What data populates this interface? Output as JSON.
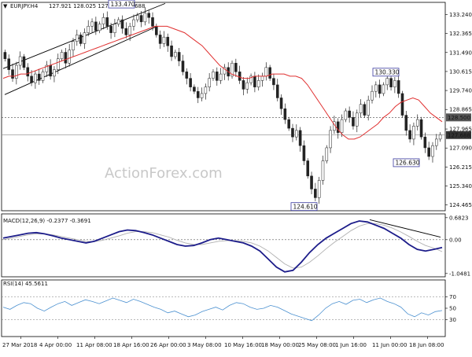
{
  "header": {
    "symbol": "EURJPY.H4",
    "ohlc": "127.921 128.025 127.602 127.688",
    "arrow": "▼"
  },
  "watermark": "ActionForex.com",
  "colors": {
    "candle": "#222222",
    "moving_average": "#e03030",
    "channel": "#000000",
    "macd_line": "#1c1c8a",
    "macd_signal": "#b0b0b0",
    "rsi_line": "#4a90d0",
    "label_border": "#3a3aa0",
    "current_price_bg": "#333333",
    "level_bg": "#555555"
  },
  "chart_data": [
    {
      "type": "candlestick",
      "title": "",
      "ylim": [
        124.2,
        133.8
      ],
      "y_ticks": [
        "133.240",
        "132.365",
        "131.490",
        "130.615",
        "129.740",
        "128.865",
        "127.965",
        "127.090",
        "126.215",
        "125.340",
        "124.465"
      ],
      "y_tick_values": [
        133.24,
        132.365,
        131.49,
        130.615,
        129.74,
        128.865,
        127.965,
        127.09,
        126.215,
        125.34,
        124.465
      ],
      "x_labels": [
        "27 Mar 2018",
        "4 Apr 00:00",
        "11 Apr 08:00",
        "18 Apr 16:00",
        "26 Apr 00:00",
        "3 May 08:00",
        "10 May 16:00",
        "18 May 00:00",
        "25 May 08:00",
        "1 Jun 16:00",
        "11 Jun 00:00",
        "18 Jun 08:00"
      ],
      "close_series": [
        131.2,
        130.7,
        130.3,
        130.9,
        131.3,
        130.8,
        130.4,
        130.1,
        130.5,
        130.2,
        130.6,
        130.9,
        130.4,
        130.7,
        131.2,
        131.5,
        131.0,
        131.6,
        132.0,
        132.3,
        131.9,
        132.4,
        132.7,
        132.9,
        132.5,
        132.8,
        133.1,
        132.7,
        132.4,
        132.8,
        133.0,
        132.6,
        132.3,
        132.7,
        133.0,
        133.2,
        132.9,
        133.3,
        133.1,
        132.7,
        132.3,
        131.9,
        132.2,
        131.8,
        131.3,
        131.5,
        131.1,
        130.6,
        130.3,
        129.9,
        129.7,
        129.4,
        129.6,
        129.9,
        130.3,
        130.6,
        130.2,
        130.5,
        130.8,
        130.4,
        131.0,
        130.6,
        130.2,
        129.8,
        130.1,
        130.4,
        129.9,
        130.2,
        130.4,
        130.8,
        130.3,
        130.0,
        129.4,
        128.9,
        128.4,
        128.0,
        127.6,
        127.9,
        127.2,
        126.5,
        125.8,
        125.2,
        124.8,
        125.6,
        126.5,
        127.1,
        127.9,
        128.3,
        127.8,
        128.4,
        128.8,
        128.5,
        128.1,
        128.7,
        129.1,
        128.6,
        129.3,
        129.7,
        130.0,
        129.6,
        130.0,
        130.3,
        129.9,
        130.2,
        129.6,
        128.6,
        127.9,
        127.5,
        128.1,
        128.4,
        127.6,
        127.1,
        126.7,
        127.2,
        127.5,
        127.7
      ],
      "ma_series": [
        130.3,
        130.4,
        130.4,
        130.5,
        130.5,
        130.6,
        130.7,
        130.8,
        130.9,
        131.0,
        131.1,
        131.2,
        131.3,
        131.4,
        131.5,
        131.6,
        131.7,
        131.8,
        131.9,
        132.0,
        132.1,
        132.2,
        132.3,
        132.4,
        132.5,
        132.6,
        132.7,
        132.7,
        132.7,
        132.6,
        132.5,
        132.4,
        132.2,
        132.0,
        131.8,
        131.5,
        131.2,
        130.9,
        130.7,
        130.5,
        130.4,
        130.3,
        130.3,
        130.4,
        130.4,
        130.4,
        130.5,
        130.5,
        130.5,
        130.4,
        130.4,
        130.3,
        130.0,
        129.6,
        129.2,
        128.8,
        128.4,
        128.0,
        127.7,
        127.5,
        127.5,
        127.6,
        127.8,
        128.0,
        128.2,
        128.5,
        128.7,
        129.0,
        129.2,
        129.3,
        129.4,
        129.3,
        129.0,
        128.7,
        128.5,
        128.3
      ],
      "resistance_level": 128.5,
      "current_price": 127.688,
      "price_labels": [
        {
          "label": "133.470",
          "value": 133.47
        },
        {
          "label": "130.330",
          "value": 130.33
        },
        {
          "label": "126.630",
          "value": 126.63
        },
        {
          "label": "124.610",
          "value": 124.61
        }
      ],
      "current_price_label": "127.688",
      "level_label": "128.500"
    },
    {
      "type": "line",
      "title": "MACD(12,26,9) -0.2377 -0.3691",
      "ylim": [
        -1.15,
        0.8
      ],
      "y_ticks": [
        "0.6823",
        "0.00",
        "-1.0481"
      ],
      "y_tick_values": [
        0.6823,
        0.0,
        -1.0481
      ],
      "series": [
        {
          "name": "MACD",
          "values": [
            0.05,
            0.1,
            0.15,
            0.2,
            0.22,
            0.18,
            0.12,
            0.05,
            0.0,
            -0.05,
            -0.1,
            -0.05,
            0.05,
            0.15,
            0.25,
            0.3,
            0.28,
            0.22,
            0.15,
            0.05,
            -0.05,
            -0.15,
            -0.2,
            -0.18,
            -0.1,
            0.0,
            0.05,
            0.0,
            -0.05,
            -0.1,
            -0.2,
            -0.35,
            -0.6,
            -0.85,
            -1.0,
            -0.95,
            -0.7,
            -0.4,
            -0.15,
            0.05,
            0.2,
            0.35,
            0.5,
            0.58,
            0.55,
            0.45,
            0.35,
            0.2,
            0.05,
            -0.15,
            -0.3,
            -0.35,
            -0.3,
            -0.24
          ]
        },
        {
          "name": "Signal",
          "values": [
            0.0,
            0.05,
            0.1,
            0.15,
            0.18,
            0.18,
            0.15,
            0.1,
            0.05,
            0.0,
            -0.05,
            -0.06,
            -0.02,
            0.05,
            0.12,
            0.2,
            0.25,
            0.25,
            0.22,
            0.15,
            0.08,
            -0.02,
            -0.1,
            -0.15,
            -0.15,
            -0.1,
            -0.05,
            -0.03,
            -0.03,
            -0.05,
            -0.1,
            -0.2,
            -0.35,
            -0.55,
            -0.75,
            -0.88,
            -0.85,
            -0.7,
            -0.5,
            -0.28,
            -0.08,
            0.1,
            0.28,
            0.42,
            0.5,
            0.5,
            0.45,
            0.36,
            0.24,
            0.1,
            -0.05,
            -0.18,
            -0.26,
            -0.37
          ]
        }
      ],
      "trendline": true
    },
    {
      "type": "line",
      "title": "RSI(14) 45.5611",
      "ylim": [
        0,
        100
      ],
      "y_ticks": [
        "70",
        "50",
        "30"
      ],
      "y_tick_values": [
        70,
        50,
        30
      ],
      "series": [
        {
          "name": "RSI",
          "values": [
            52,
            48,
            55,
            60,
            58,
            50,
            45,
            52,
            58,
            62,
            55,
            60,
            65,
            62,
            58,
            63,
            68,
            64,
            60,
            66,
            62,
            57,
            52,
            48,
            42,
            45,
            40,
            35,
            38,
            44,
            48,
            52,
            47,
            55,
            60,
            58,
            52,
            48,
            50,
            55,
            52,
            46,
            40,
            36,
            32,
            28,
            38,
            50,
            58,
            62,
            57,
            64,
            66,
            60,
            65,
            68,
            62,
            58,
            52,
            40,
            35,
            42,
            38,
            44,
            46
          ]
        }
      ]
    }
  ]
}
